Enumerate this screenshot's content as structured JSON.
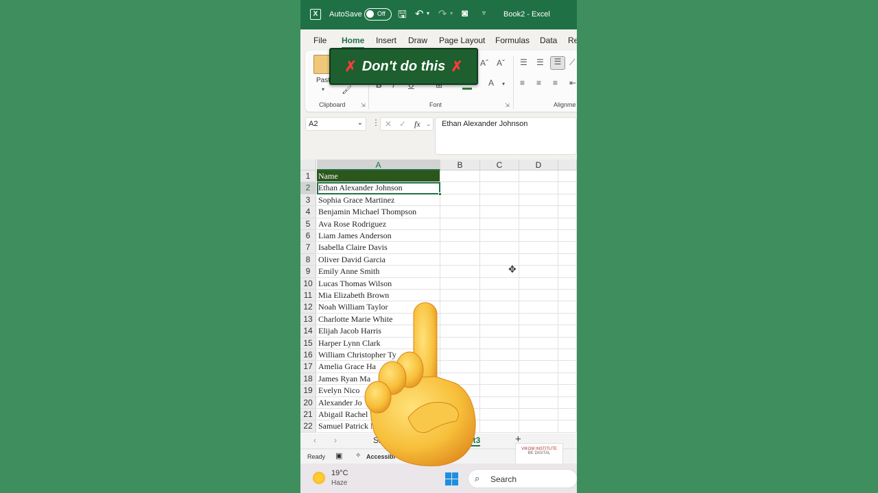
{
  "title_bar": {
    "autosave_label": "AutoSave",
    "autosave_state": "Off",
    "document_title": "Book2  -  Excel"
  },
  "ribbon_tabs": [
    "File",
    "Home",
    "Insert",
    "Draw",
    "Page Layout",
    "Formulas",
    "Data",
    "Re"
  ],
  "ribbon": {
    "paste_label": "Past",
    "clipboard_group": "Clipboard",
    "font_group": "Font",
    "alignment_group": "Alignme"
  },
  "overlay_banner": {
    "text": "Don't do this",
    "mark": "✗"
  },
  "formula_bar": {
    "name_box": "A2",
    "formula_value": "Ethan Alexander Johnson",
    "fx_label": "fx"
  },
  "columns": [
    "A",
    "B",
    "C",
    "D"
  ],
  "rows": [
    {
      "n": "1",
      "a": "Name"
    },
    {
      "n": "2",
      "a": "Ethan Alexander Johnson"
    },
    {
      "n": "3",
      "a": "Sophia Grace Martinez"
    },
    {
      "n": "4",
      "a": "Benjamin Michael Thompson"
    },
    {
      "n": "5",
      "a": "Ava Rose Rodriguez"
    },
    {
      "n": "6",
      "a": "Liam James Anderson"
    },
    {
      "n": "7",
      "a": "Isabella Claire Davis"
    },
    {
      "n": "8",
      "a": "Oliver David Garcia"
    },
    {
      "n": "9",
      "a": "Emily Anne Smith"
    },
    {
      "n": "10",
      "a": "Lucas Thomas Wilson"
    },
    {
      "n": "11",
      "a": "Mia Elizabeth Brown"
    },
    {
      "n": "12",
      "a": "Noah William Taylor"
    },
    {
      "n": "13",
      "a": "Charlotte Marie White"
    },
    {
      "n": "14",
      "a": "Elijah Jacob Harris"
    },
    {
      "n": "15",
      "a": "Harper Lynn Clark"
    },
    {
      "n": "16",
      "a": "William Christopher Ty"
    },
    {
      "n": "17",
      "a": "Amelia Grace Ha"
    },
    {
      "n": "18",
      "a": "James Ryan Ma"
    },
    {
      "n": "19",
      "a": "Evelyn Nico"
    },
    {
      "n": "20",
      "a": "Alexander Jo"
    },
    {
      "n": "21",
      "a": "Abigail Rachel"
    },
    {
      "n": "22",
      "a": "Samuel Patrick N"
    }
  ],
  "sheet_tabs": {
    "sheet1_partial": "She",
    "sheet3_partial": "et3",
    "add_sheet": "+"
  },
  "status_bar": {
    "ready": "Ready",
    "accessibility": "Accessibi"
  },
  "watermark": {
    "line1": "VIKOM INSTITUTE",
    "line2": "BE DIGITAL"
  },
  "taskbar": {
    "temperature": "19°C",
    "weather": "Haze",
    "search_label": "Search"
  },
  "colors": {
    "excel_green": "#1f7145",
    "header_fill": "#2b561c",
    "banner_fill": "#1d5f2e",
    "banner_x": "#ff3b3b",
    "background": "#3f8f5e"
  },
  "icons": [
    "excel-logo-icon",
    "save-icon",
    "undo-icon",
    "redo-icon",
    "camera-icon",
    "customize-icon",
    "paste-icon",
    "format-painter-icon",
    "cancel-icon",
    "enter-icon",
    "add-sheet-icon",
    "weather-icon",
    "windows-icon",
    "search-icon",
    "pointing-hand-emoji"
  ]
}
